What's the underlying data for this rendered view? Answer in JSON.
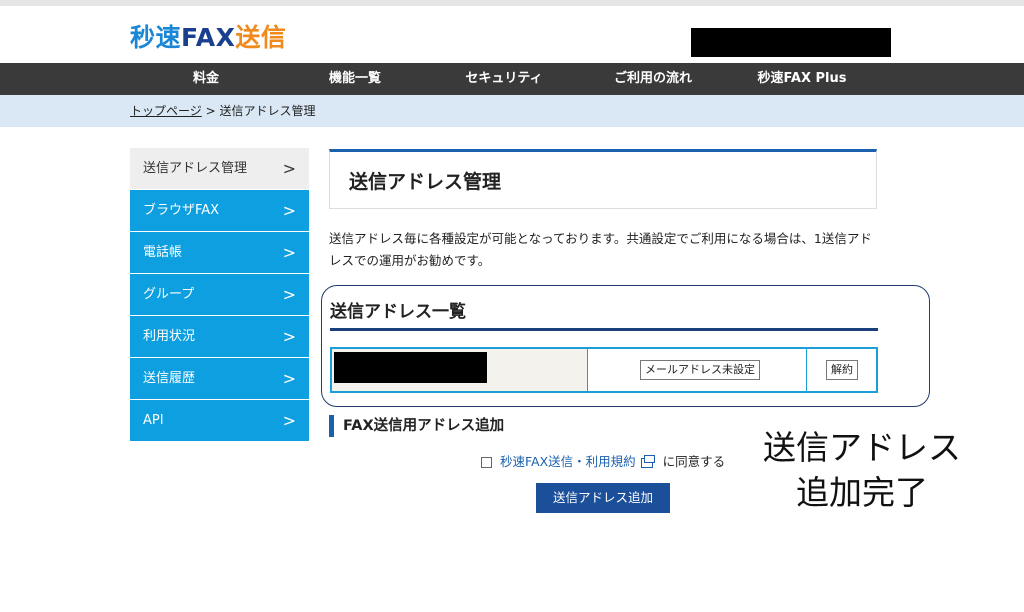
{
  "logo": {
    "part1": "秒速",
    "part2": "FAX",
    "part3": "送信"
  },
  "nav": [
    "料金",
    "機能一覧",
    "セキュリティ",
    "ご利用の流れ",
    "秒速FAX Plus"
  ],
  "breadcrumb": {
    "home": "トップページ",
    "separator": " > ",
    "current": "送信アドレス管理"
  },
  "sidebar": [
    {
      "label": "送信アドレス管理",
      "active": true
    },
    {
      "label": "ブラウザFAX"
    },
    {
      "label": "電話帳"
    },
    {
      "label": "グループ"
    },
    {
      "label": "利用状況"
    },
    {
      "label": "送信履歴"
    },
    {
      "label": "API"
    }
  ],
  "chevron": ">",
  "page": {
    "title": "送信アドレス管理",
    "description": "送信アドレス毎に各種設定が可能となっております。共通設定でご利用になる場合は、1送信アドレスでの運用がお勧めです。"
  },
  "address_list": {
    "title": "送信アドレス一覧",
    "rows": [
      {
        "mail_button": "メールアドレス未設定",
        "cancel_button": "解約"
      }
    ]
  },
  "add_section": {
    "title": "FAX送信用アドレス追加",
    "terms_link": "秒速FAX送信・利用規約",
    "agree_text": "に同意する",
    "submit": "送信アドレス追加"
  },
  "annotation": {
    "line1": "送信アドレス",
    "line2": "追加完了"
  },
  "colors": {
    "brand_blue": "#1a86d6",
    "brand_navy": "#1a3f8f",
    "brand_orange": "#f08a1c",
    "sidebar_blue": "#0d9fe0",
    "nav_dark": "#3a3a3a",
    "button_blue": "#1b4f9a"
  }
}
